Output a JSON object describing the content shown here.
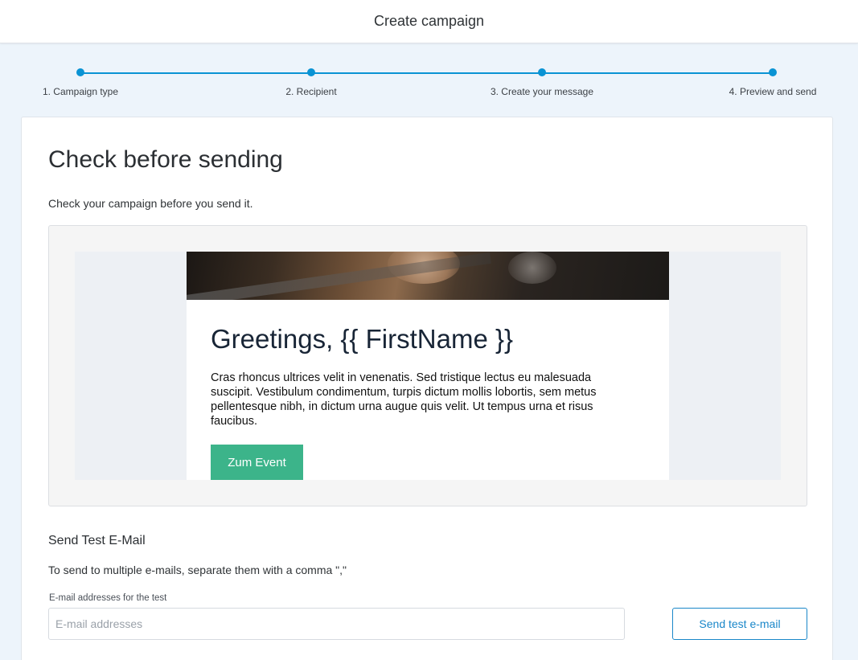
{
  "header": {
    "title": "Create campaign"
  },
  "stepper": {
    "steps": [
      {
        "label": "1. Campaign type"
      },
      {
        "label": "2. Recipient"
      },
      {
        "label": "3. Create your message"
      },
      {
        "label": "4. Preview and send"
      }
    ],
    "accent_color": "#0a93d4"
  },
  "main": {
    "title": "Check before sending",
    "subtitle": "Check your campaign before you send it."
  },
  "email_preview": {
    "greeting": "Greetings, {{ FirstName }}",
    "body": "Cras rhoncus ultrices velit in venenatis. Sed tristique lectus eu malesuada suscipit. Vestibulum condimentum, turpis dictum mollis lobortis, sem metus pellentesque nibh, in dictum urna augue quis velit. Ut tempus urna et risus faucibus.",
    "cta_label": "Zum Event",
    "cta_color": "#3cb48a"
  },
  "test_email": {
    "title": "Send Test E-Mail",
    "hint": "To send to multiple e-mails, separate them with a comma \",\"",
    "field_label": "E-mail addresses for the test",
    "placeholder": "E-mail addresses",
    "value": "",
    "send_label": "Send test e-mail"
  }
}
